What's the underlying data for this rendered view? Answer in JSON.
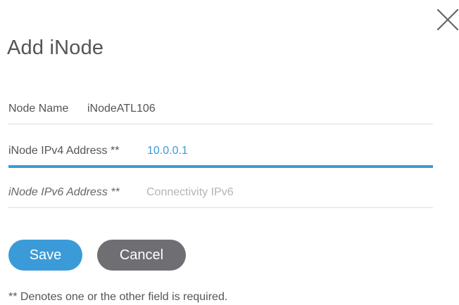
{
  "dialog": {
    "title": "Add iNode",
    "close_icon": "close-icon"
  },
  "fields": {
    "node_name": {
      "label": "Node Name",
      "value": "iNodeATL106"
    },
    "ipv4": {
      "label": "iNode IPv4 Address **",
      "value": "10.0.0.1",
      "focused": true
    },
    "ipv6": {
      "label": "iNode IPv6 Address **",
      "value": "",
      "placeholder": "Connectivity IPv6"
    }
  },
  "buttons": {
    "save_label": "Save",
    "cancel_label": "Cancel"
  },
  "footnote": "** Denotes one or the other field is required.",
  "colors": {
    "accent": "#3a9bd8",
    "cancel": "#6e6e73",
    "divider": "#dddddd",
    "placeholder": "#b4b4b4"
  }
}
